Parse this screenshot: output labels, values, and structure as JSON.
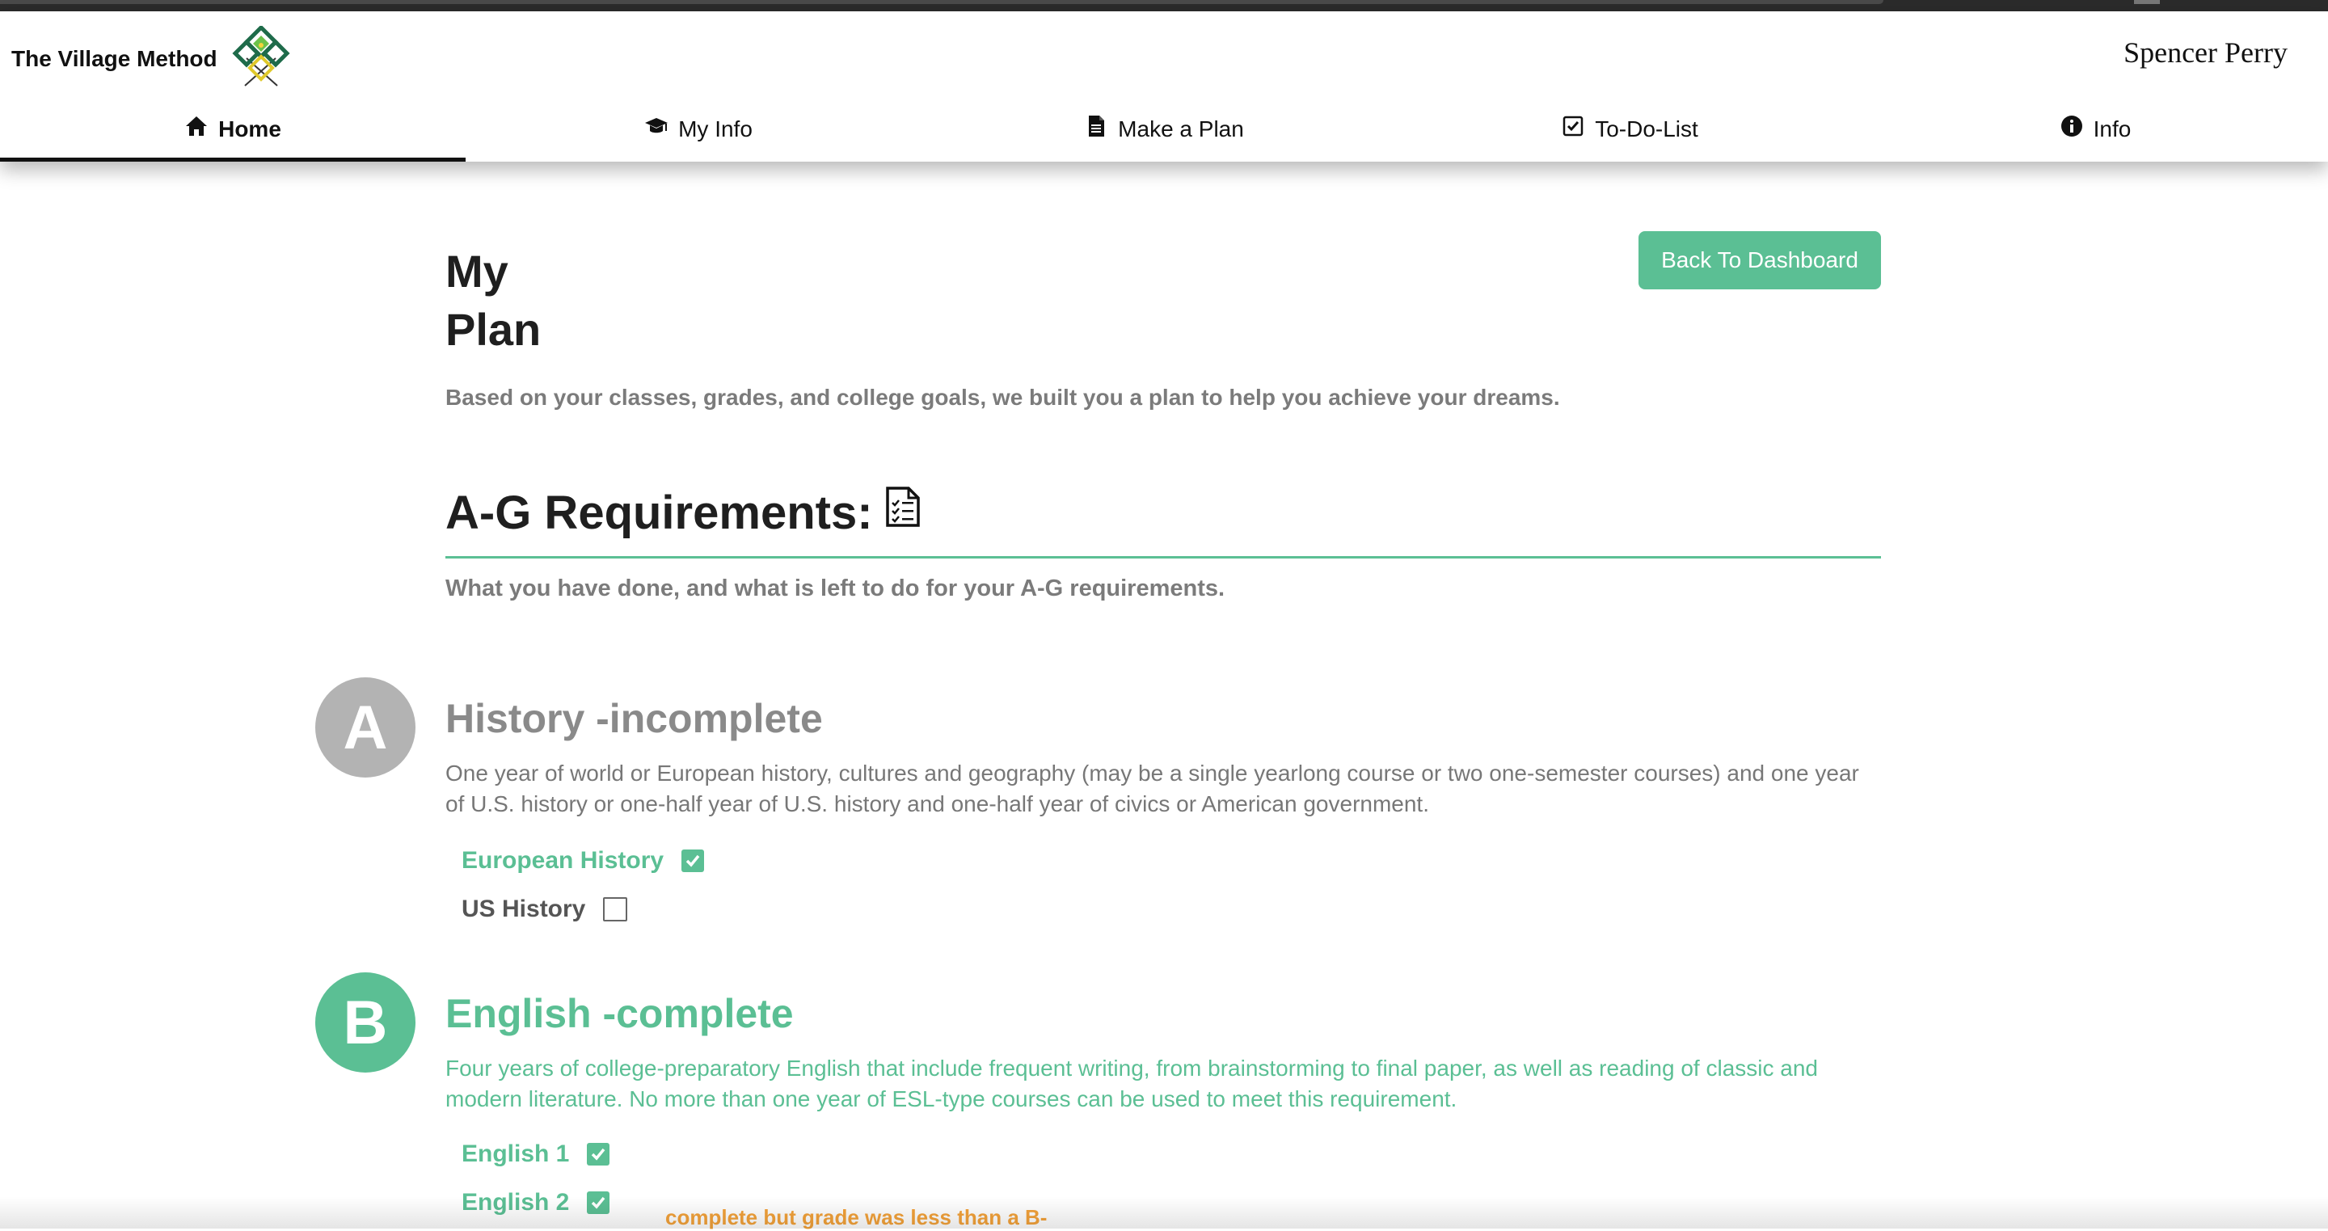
{
  "app": {
    "brand_name": "The Village Method",
    "logo_icon": "village-logo-icon",
    "user_name": "Spencer Perry"
  },
  "nav": {
    "tabs": [
      {
        "label": "Home",
        "icon": "home-icon",
        "active": true
      },
      {
        "label": "My Info",
        "icon": "graduation-cap-icon",
        "active": false
      },
      {
        "label": "Make a Plan",
        "icon": "document-icon",
        "active": false
      },
      {
        "label": "To-Do-List",
        "icon": "checkbox-icon",
        "active": false
      },
      {
        "label": "Info",
        "icon": "info-icon",
        "active": false
      }
    ]
  },
  "page": {
    "title": "My Plan",
    "back_button": "Back To Dashboard",
    "subtitle": "Based on your classes, grades, and college goals, we built you a plan to help you achieve your dreams."
  },
  "ag": {
    "title": "A-G Requirements:",
    "title_icon": "checklist-icon",
    "subtitle": "What you have done, and what is left to do for your A-G requirements.",
    "requirements": [
      {
        "letter": "A",
        "title": "History -incomplete",
        "status": "incomplete",
        "description": "One year of world or European history, cultures and geography (may be a single yearlong course or two one-semester courses) and one year of U.S. history or one-half year of U.S. history and one-half year of civics or American government.",
        "courses": [
          {
            "name": "European History",
            "checked": true
          },
          {
            "name": "US History",
            "checked": false
          }
        ]
      },
      {
        "letter": "B",
        "title": "English -complete",
        "status": "complete",
        "description": "Four years of college-preparatory English that include frequent writing, from brainstorming to final paper, as well as reading of classic and modern literature. No more than one year of ESL-type courses can be used to meet this requirement.",
        "courses": [
          {
            "name": "English 1",
            "checked": true
          },
          {
            "name": "English 2",
            "checked": true,
            "note": "complete but grade was less than a B-"
          }
        ]
      }
    ]
  },
  "colors": {
    "accent": "#5bbf94",
    "incomplete": "#b3b3b3",
    "warning": "#f3a23a"
  }
}
